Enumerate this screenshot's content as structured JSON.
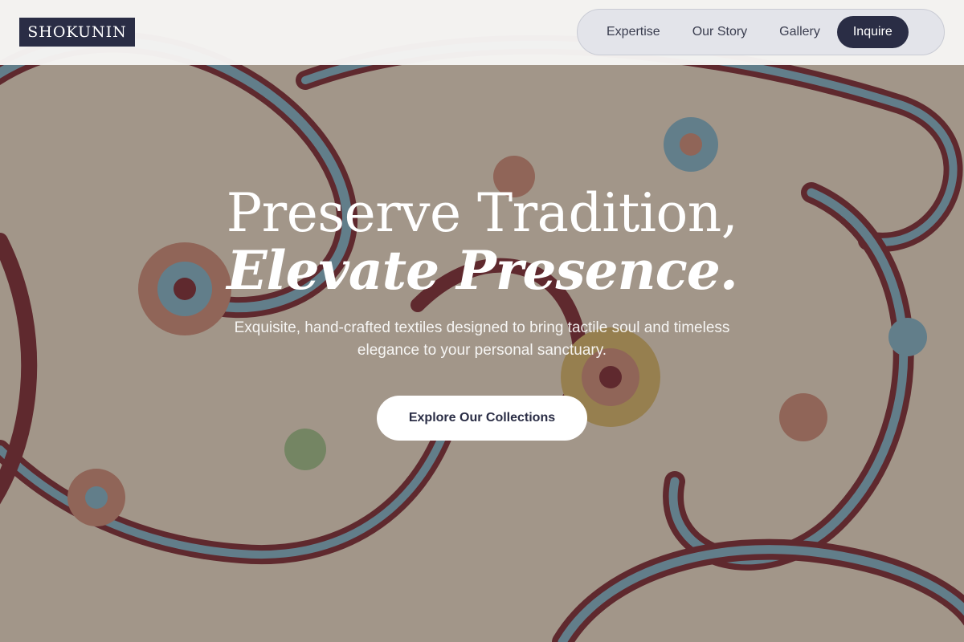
{
  "brand": {
    "logo_text": "SHOKUNIN"
  },
  "nav": {
    "items": [
      {
        "label": "Expertise"
      },
      {
        "label": "Our Story"
      },
      {
        "label": "Gallery"
      }
    ],
    "cta_label": "Inquire"
  },
  "hero": {
    "title_line1": "Preserve Tradition,",
    "title_line2": "Elevate Presence.",
    "subtitle": "Exquisite, hand-crafted textiles designed to bring tactile soul and timeless elegance to your personal sanctuary.",
    "button_label": "Explore Our Collections",
    "background_image": "paisley-textile-pattern"
  },
  "colors": {
    "brand_navy": "#2a2d45",
    "header_bg": "#f6f5f4",
    "nav_pill_bg": "#e3e4ea",
    "paisley_maroon": "#7a2a35",
    "paisley_blue": "#7fb3c8",
    "paisley_cream": "#e8dccb"
  }
}
